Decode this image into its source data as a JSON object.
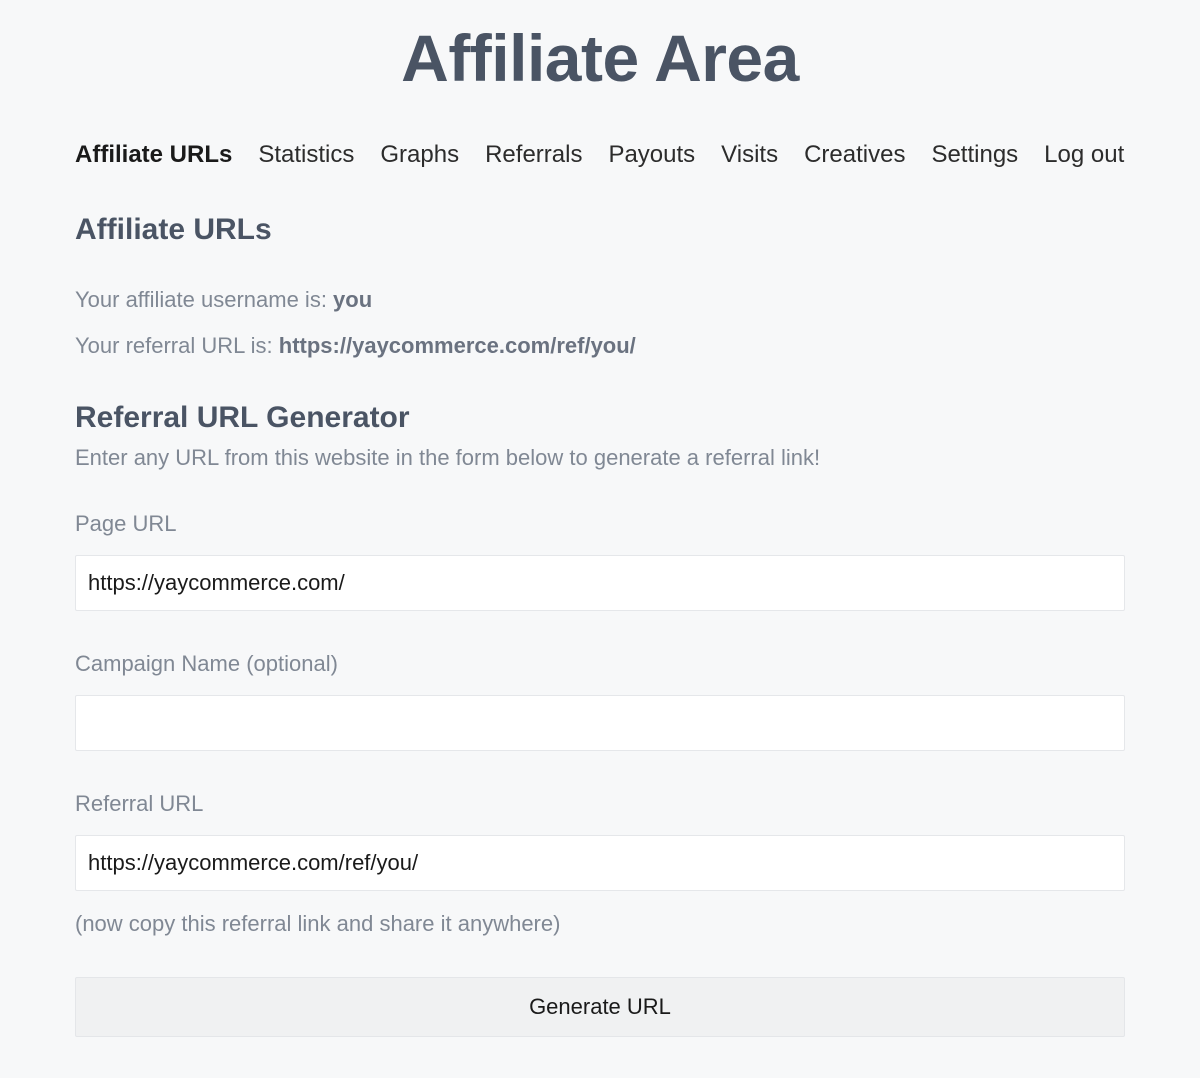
{
  "page_title": "Affiliate Area",
  "tabs": [
    {
      "label": "Affiliate URLs",
      "active": true
    },
    {
      "label": "Statistics",
      "active": false
    },
    {
      "label": "Graphs",
      "active": false
    },
    {
      "label": "Referrals",
      "active": false
    },
    {
      "label": "Payouts",
      "active": false
    },
    {
      "label": "Visits",
      "active": false
    },
    {
      "label": "Creatives",
      "active": false
    },
    {
      "label": "Settings",
      "active": false
    },
    {
      "label": "Log out",
      "active": false
    }
  ],
  "section": {
    "heading": "Affiliate URLs",
    "username_label": "Your affiliate username is: ",
    "username_value": "you",
    "referral_label": "Your referral URL is: ",
    "referral_value": "https://yaycommerce.com/ref/you/"
  },
  "generator": {
    "heading": "Referral URL Generator",
    "description": "Enter any URL from this website in the form below to generate a referral link!",
    "page_url_label": "Page URL",
    "page_url_value": "https://yaycommerce.com/",
    "campaign_label": "Campaign Name (optional)",
    "campaign_value": "",
    "referral_url_label": "Referral URL",
    "referral_url_value": "https://yaycommerce.com/ref/you/",
    "hint": "(now copy this referral link and share it anywhere)",
    "button_label": "Generate URL"
  }
}
